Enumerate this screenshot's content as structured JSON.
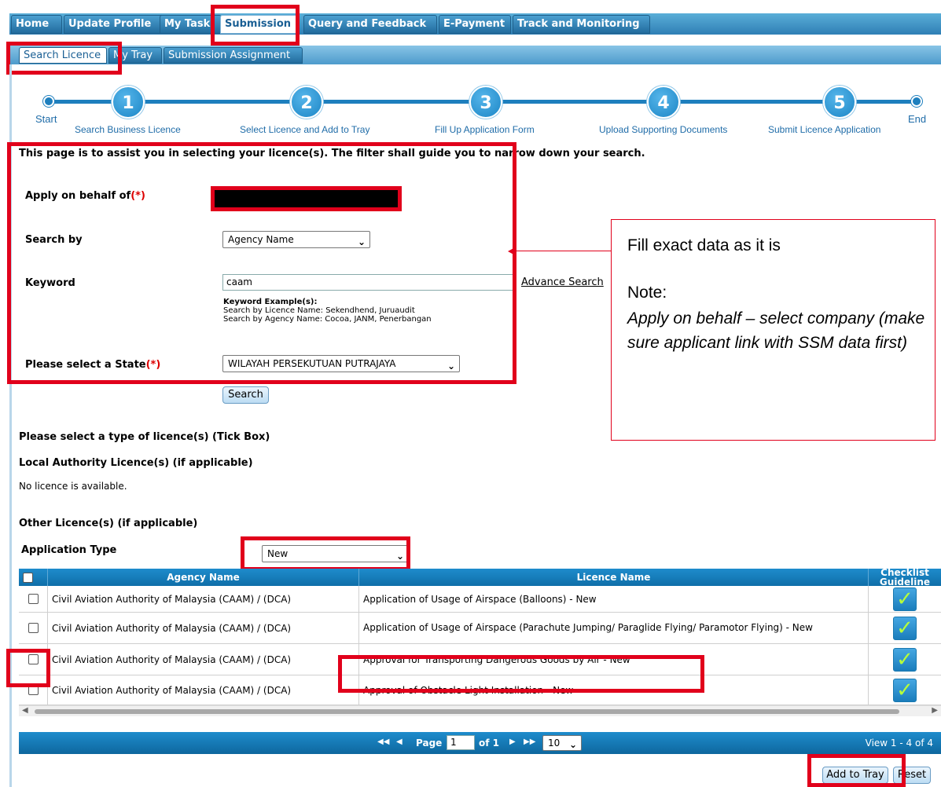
{
  "top_tabs": [
    "Home",
    "Update Profile",
    "My Task",
    "Submission",
    "Query and Feedback",
    "E-Payment",
    "Track and Monitoring"
  ],
  "sub_tabs": [
    "Search Licence",
    "My Tray",
    "Submission Assignment"
  ],
  "stepper": {
    "start": "Start",
    "end": "End",
    "steps": [
      {
        "num": "1",
        "label": "Search Business Licence"
      },
      {
        "num": "2",
        "label": "Select Licence and Add to Tray"
      },
      {
        "num": "3",
        "label": "Fill Up Application Form"
      },
      {
        "num": "4",
        "label": "Upload Supporting Documents"
      },
      {
        "num": "5",
        "label": "Submit Licence Application"
      }
    ]
  },
  "intro": "This page is to assist you in selecting your licence(s). The filter shall guide you to narrow down your search.",
  "form": {
    "apply_label": "Apply on behalf of",
    "req_mark": "(*)",
    "search_by_label": "Search by",
    "search_by_value": "Agency Name",
    "keyword_label": "Keyword",
    "keyword_value": "caam",
    "advance_search": "Advance Search",
    "keyword_example_title": "Keyword Example(s):",
    "keyword_example_1": "Search by Licence Name: Sekendhend, Juruaudit",
    "keyword_example_2": "Search by Agency Name: Cocoa, JANM, Penerbangan",
    "state_label": "Please select a State",
    "state_value": "WILAYAH PERSEKUTUAN PUTRAJAYA",
    "search_button": "Search"
  },
  "licence_section": {
    "select_type": "Please select a type of licence(s) (Tick Box)",
    "local_authority": "Local Authority Licence(s) (if applicable)",
    "no_licence": "No licence is available.",
    "other": "Other Licence(s) (if applicable)",
    "application_type_label": "Application Type",
    "application_type_value": "New"
  },
  "table": {
    "headers": {
      "agency": "Agency Name",
      "licence": "Licence Name",
      "checklist": "Checklist Guideline"
    },
    "rows": [
      {
        "agency": "Civil Aviation Authority of Malaysia (CAAM) / (DCA)",
        "licence": "Application of Usage of Airspace (Balloons) - New"
      },
      {
        "agency": "Civil Aviation Authority of Malaysia (CAAM) / (DCA)",
        "licence": "Application of Usage of Airspace (Parachute Jumping/ Paraglide Flying/ Paramotor Flying) - New"
      },
      {
        "agency": "Civil Aviation Authority of Malaysia (CAAM) / (DCA)",
        "licence": "Approval for Transporting Dangerous Goods by Air - New"
      },
      {
        "agency": "Civil Aviation Authority of Malaysia (CAAM) / (DCA)",
        "licence": "Approval of Obstacle Light Installation - New"
      }
    ]
  },
  "pager": {
    "page_label": "Page",
    "page_value": "1",
    "of_label": "of 1",
    "page_size": "10",
    "view_text": "View 1 - 4 of 4"
  },
  "buttons": {
    "add_to_tray": "Add to Tray",
    "reset": "Reset"
  },
  "annotation": {
    "line1": "Fill exact data as it is",
    "line2": "Note:",
    "line3": "Apply on behalf – select company (make sure applicant link with SSM data first)"
  },
  "colors": {
    "accent": "#1e7fbe",
    "highlight": "#e1001b"
  }
}
